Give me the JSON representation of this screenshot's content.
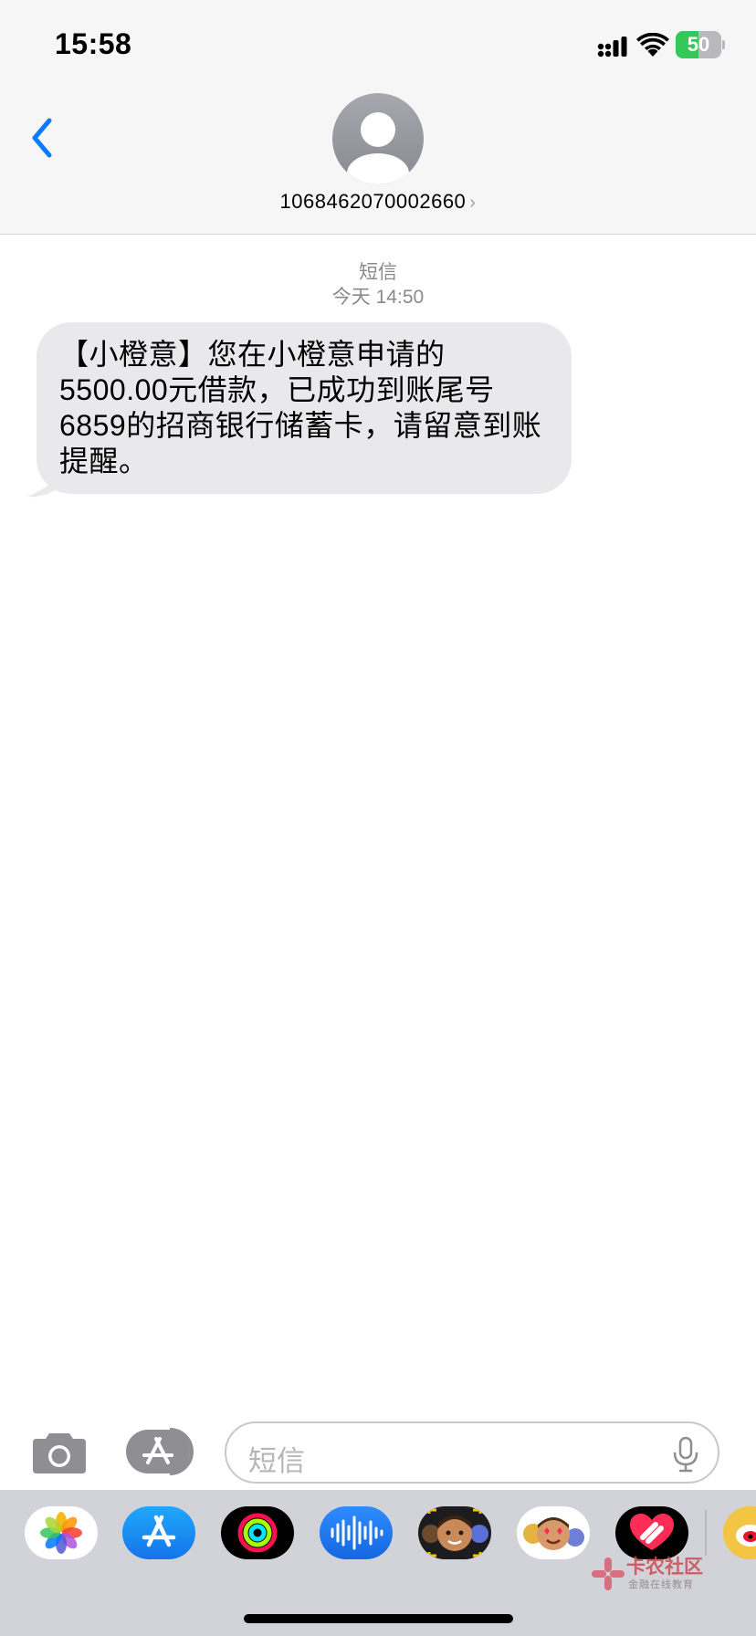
{
  "status_bar": {
    "time": "15:58",
    "battery_level": "50",
    "battery_fraction": 0.5
  },
  "header": {
    "contact_number": "1068462070002660",
    "chevron": "›"
  },
  "conversation": {
    "service_label": "短信",
    "timestamp": "今天 14:50",
    "messages": [
      {
        "direction": "incoming",
        "text": "【小橙意】您在小橙意申请的5500.00元借款，已成功到账尾号6859的招商银行储蓄卡，请留意到账提醒。"
      }
    ]
  },
  "composer": {
    "placeholder": "短信"
  },
  "app_drawer": {
    "apps": [
      "photos-app-icon",
      "app-store-app-icon",
      "activity-app-icon",
      "audio-message-app-icon",
      "memoji-app-icon",
      "memoji-stickers-app-icon",
      "digital-touch-app-icon",
      "weibo-app-icon"
    ]
  },
  "watermark": {
    "title": "卡农社区",
    "subtitle": "金融在线教育"
  },
  "colors": {
    "accent": "#0a7aff",
    "bubble_incoming": "#e9e9eb",
    "battery_green": "#34c759",
    "header_bg": "#f6f6f6",
    "drawer_bg": "#d1d3d9"
  }
}
